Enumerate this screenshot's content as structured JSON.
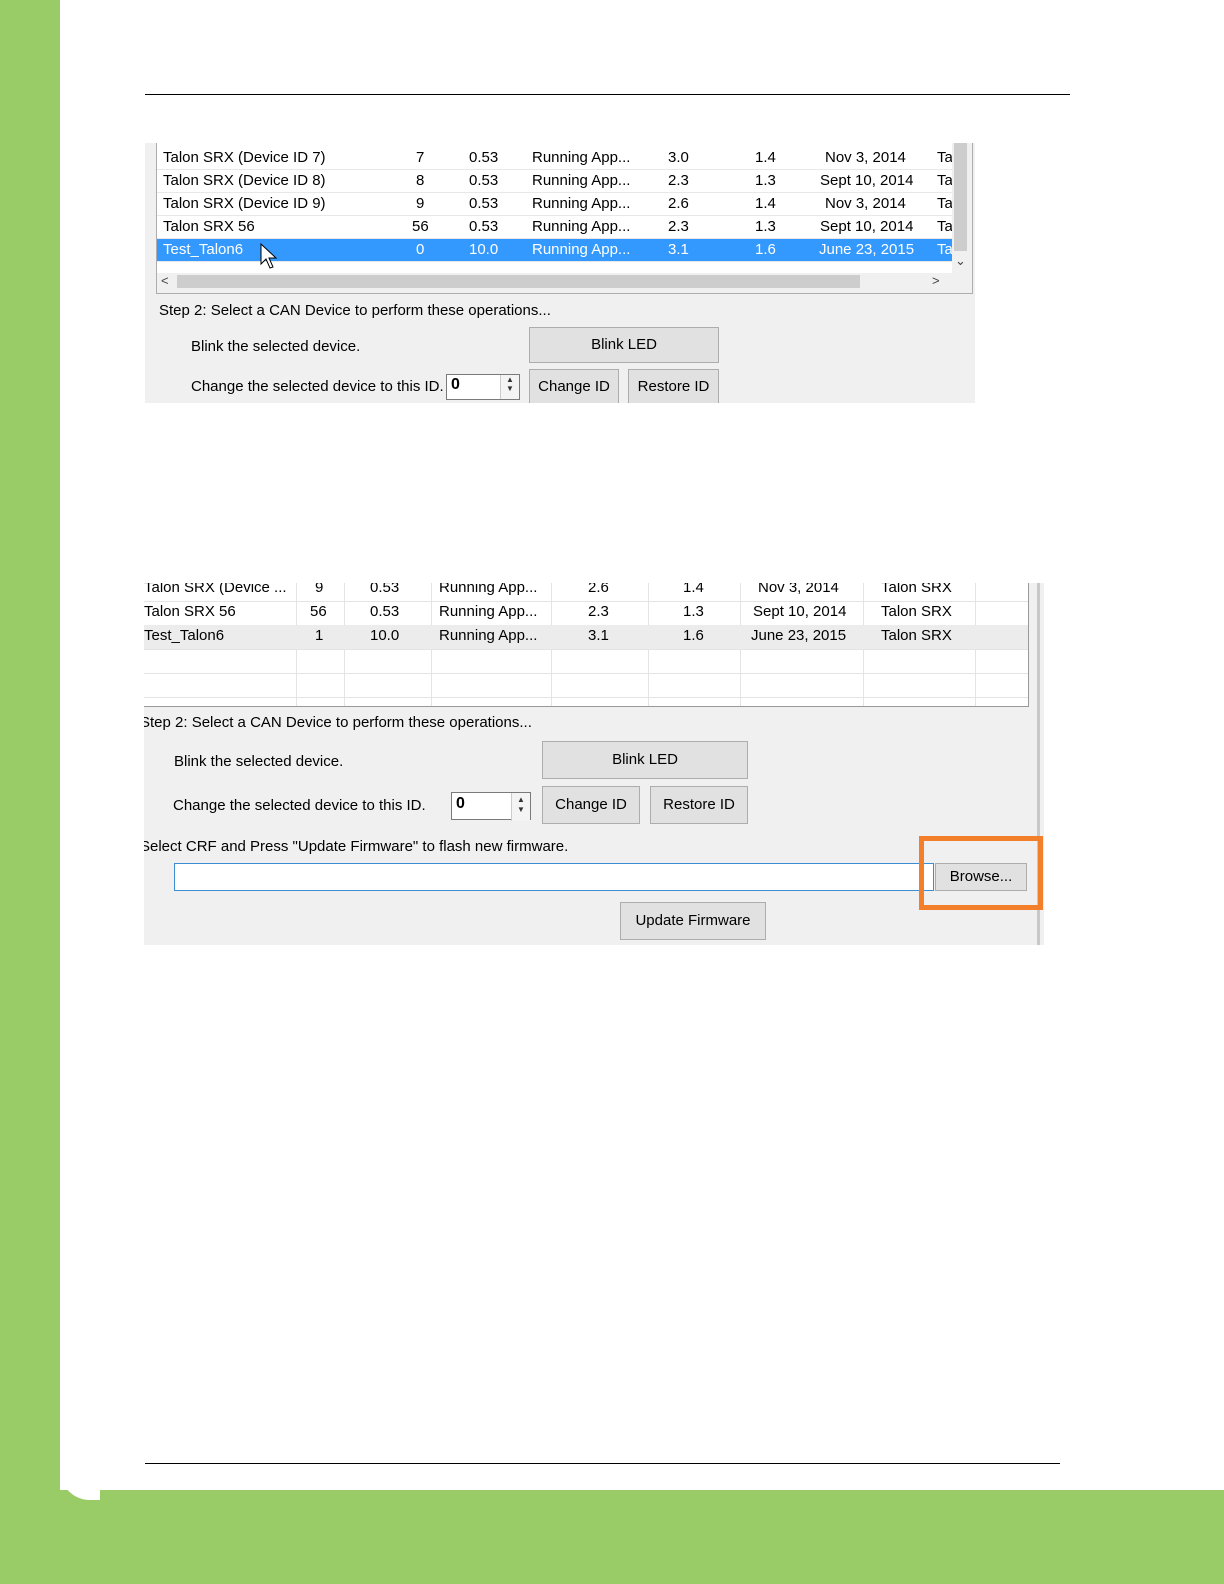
{
  "screenshot1": {
    "rows": [
      {
        "name": "Talon SRX (Device ID 7)",
        "id": "7",
        "hw": "0.53",
        "status": "Running App...",
        "bootloader": "3.0",
        "mfg": "1.4",
        "date": "Nov 3, 2014",
        "model": "Ta"
      },
      {
        "name": "Talon SRX (Device ID 8)",
        "id": "8",
        "hw": "0.53",
        "status": "Running App...",
        "bootloader": "2.3",
        "mfg": "1.3",
        "date": "Sept 10, 2014",
        "model": "Ta"
      },
      {
        "name": "Talon SRX (Device ID 9)",
        "id": "9",
        "hw": "0.53",
        "status": "Running App...",
        "bootloader": "2.6",
        "mfg": "1.4",
        "date": "Nov 3, 2014",
        "model": "Ta"
      },
      {
        "name": "Talon SRX 56",
        "id": "56",
        "hw": "0.53",
        "status": "Running App...",
        "bootloader": "2.3",
        "mfg": "1.3",
        "date": "Sept 10, 2014",
        "model": "Ta"
      },
      {
        "name": "Test_Talon6",
        "id": "0",
        "hw": "10.0",
        "status": "Running App...",
        "bootloader": "3.1",
        "mfg": "1.6",
        "date": "June 23, 2015",
        "model": "Ta"
      }
    ],
    "step2_label": "Step 2: Select a CAN Device to perform these operations...",
    "blink_label": "Blink the selected device.",
    "blink_button": "Blink LED",
    "change_label": "Change the selected device to this ID.",
    "id_value": "0",
    "change_button": "Change ID",
    "restore_button": "Restore ID"
  },
  "screenshot2": {
    "rows": [
      {
        "name": "Talon SRX (Device ...",
        "id": "9",
        "hw": "0.53",
        "status": "Running App...",
        "bootloader": "2.6",
        "mfg": "1.4",
        "date": "Nov 3, 2014",
        "model": "Talon SRX"
      },
      {
        "name": "Talon SRX 56",
        "id": "56",
        "hw": "0.53",
        "status": "Running App...",
        "bootloader": "2.3",
        "mfg": "1.3",
        "date": "Sept 10, 2014",
        "model": "Talon SRX"
      },
      {
        "name": "Test_Talon6",
        "id": "1",
        "hw": "10.0",
        "status": "Running App...",
        "bootloader": "3.1",
        "mfg": "1.6",
        "date": "June 23, 2015",
        "model": "Talon SRX"
      }
    ],
    "step2_label": "Step 2: Select a CAN Device to perform these operations...",
    "blink_label": "Blink the selected device.",
    "blink_button": "Blink LED",
    "change_label": "Change the selected device to this ID.",
    "id_value": "0",
    "change_button": "Change ID",
    "restore_button": "Restore ID",
    "crf_label": "Select CRF and Press \"Update Firmware\" to flash new firmware.",
    "browse_button": "Browse...",
    "update_button": "Update Firmware"
  },
  "colors": {
    "accent_green": "#99cc66",
    "highlight_orange": "#f47f2a",
    "selection_blue": "#3399ff"
  }
}
